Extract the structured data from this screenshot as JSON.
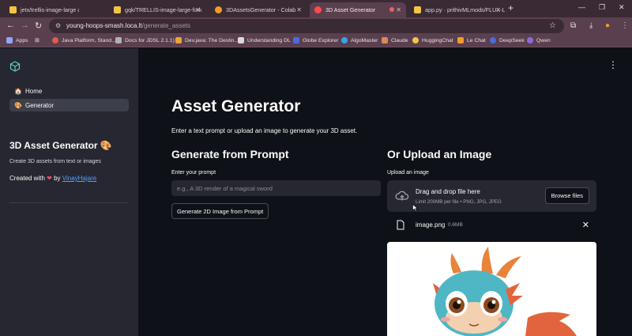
{
  "browser": {
    "tabs": [
      {
        "title": "jetx/trellis-image-large at main",
        "favicon_color": "#f4c542",
        "active": false
      },
      {
        "title": "gqk/TRELLIS-image-large-fork",
        "favicon_color": "#f4c542",
        "active": false
      },
      {
        "title": "3DAssetsGenerator - Colab",
        "favicon_color": "#f29b2b",
        "active": false
      },
      {
        "title": "3D Asset Generator",
        "favicon_color": "#ff4b4b",
        "active": true
      },
      {
        "title": "app.py · prithivMLmods/FLUX-L",
        "favicon_color": "#f4c542",
        "active": false
      }
    ],
    "url_host": "young-hoops-smash.loca.lt",
    "url_path": "/generate_assets",
    "bookmarks": [
      {
        "label": "Apps",
        "color": "#8fa7ff"
      },
      {
        "label": "Java Platform, Stand...",
        "color": "#e05b4b"
      },
      {
        "label": "Docs for JDSL 2.1.1)",
        "color": "#b0b0b0"
      },
      {
        "label": "Dev.java: The Destin...",
        "color": "#e8a33a"
      },
      {
        "label": "Understanding DL",
        "color": "#d9d9d9"
      },
      {
        "label": "Globe Explorer",
        "color": "#4b6bd9"
      },
      {
        "label": "AlgoMaster",
        "color": "#3aa3e8"
      },
      {
        "label": "Claude",
        "color": "#d98a5b"
      },
      {
        "label": "HuggingChat",
        "color": "#f4c542"
      },
      {
        "label": "Le Chat",
        "color": "#f29b2b"
      },
      {
        "label": "DeepSeek",
        "color": "#4b6bd9"
      },
      {
        "label": "Qwen",
        "color": "#8a6bd9"
      }
    ]
  },
  "sidebar": {
    "nav": [
      {
        "emoji": "🏠",
        "label": "Home",
        "active": false
      },
      {
        "emoji": "🎨",
        "label": "Generator",
        "active": true
      }
    ],
    "title": "3D Asset Generator 🎨",
    "subtitle": "Create 3D assets from text or images",
    "credit_prefix": "Created with",
    "credit_by": "by",
    "credit_author": "VinayHajare"
  },
  "main": {
    "title": "Asset Generator",
    "intro": "Enter a text prompt or upload an image to generate your 3D asset.",
    "prompt_section": {
      "heading": "Generate from Prompt",
      "label": "Enter your prompt",
      "placeholder": "e.g., A 3D render of a magical sword",
      "button": "Generate 2D Image from Prompt"
    },
    "upload_section": {
      "heading": "Or Upload an Image",
      "label": "Upload an image",
      "drop_title": "Drag and drop file here",
      "drop_limit": "Limit 200MB per file • PNG, JPG, JPEG",
      "browse_button": "Browse files",
      "file_name": "image.png",
      "file_size": "0.6MB"
    }
  },
  "colors": {
    "accent": "#ff4b4b",
    "link": "#4ea1ff",
    "app_bg": "#0e1117",
    "sidebar_bg": "#262730"
  }
}
